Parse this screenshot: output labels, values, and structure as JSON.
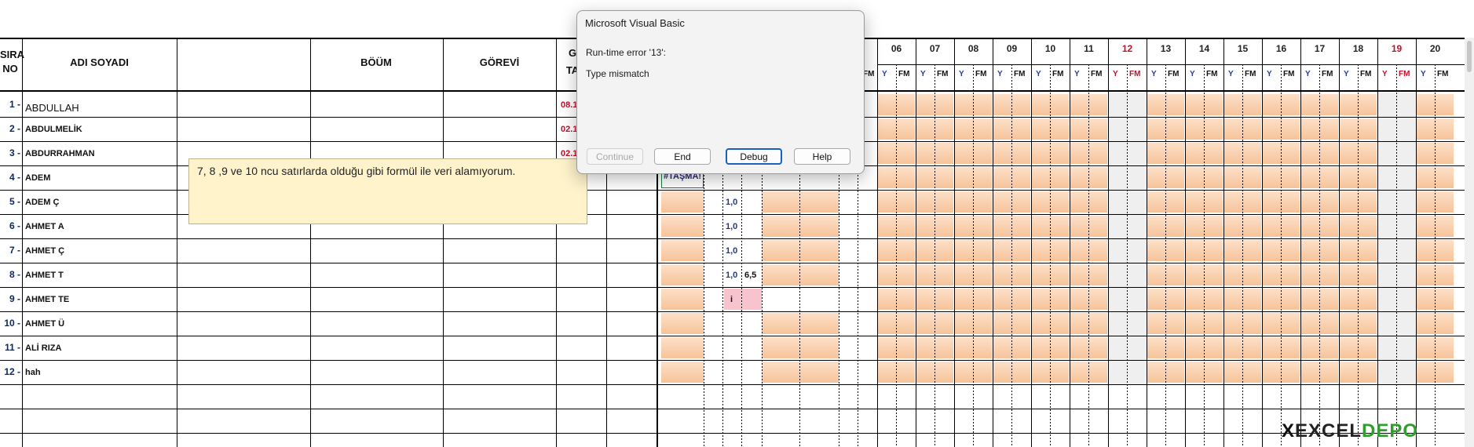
{
  "header": {
    "sira_line1": "SIRA",
    "sira_line2": "NO",
    "adi_soyadi": "ADI SOYADI",
    "bolum": "BÖÜM",
    "gorevi": "GÖREVİ",
    "g_partial": "G",
    "ta_partial": "TA",
    "fm_partial": "FM"
  },
  "days": [
    {
      "label": "06",
      "red": false
    },
    {
      "label": "07",
      "red": false
    },
    {
      "label": "08",
      "red": false
    },
    {
      "label": "09",
      "red": false
    },
    {
      "label": "10",
      "red": false
    },
    {
      "label": "11",
      "red": false
    },
    {
      "label": "12",
      "red": true
    },
    {
      "label": "13",
      "red": false
    },
    {
      "label": "14",
      "red": false
    },
    {
      "label": "15",
      "red": false
    },
    {
      "label": "16",
      "red": false
    },
    {
      "label": "17",
      "red": false
    },
    {
      "label": "18",
      "red": false
    },
    {
      "label": "19",
      "red": true
    },
    {
      "label": "20",
      "red": false
    }
  ],
  "yfm": {
    "y": "Y",
    "fm": "FM"
  },
  "rows": [
    {
      "no": "1 -",
      "name": "ABDULLAH",
      "date": "08.1"
    },
    {
      "no": "2 -",
      "name": "ABDULMELİK",
      "date": "02.1"
    },
    {
      "no": "3 -",
      "name": "ABDURRAHMAN",
      "date": "02.1"
    },
    {
      "no": "4 -",
      "name": "ADEM",
      "date": ""
    },
    {
      "no": "5 -",
      "name": "ADEM Ç",
      "date": ""
    },
    {
      "no": "6 -",
      "name": "AHMET A",
      "date": ""
    },
    {
      "no": "7 -",
      "name": "AHMET Ç",
      "date": ""
    },
    {
      "no": "8 -",
      "name": "AHMET T",
      "date": ""
    },
    {
      "no": "9 -",
      "name": "AHMET TE",
      "date": ""
    },
    {
      "no": "10 -",
      "name": "AHMET Ü",
      "date": ""
    },
    {
      "no": "11 -",
      "name": "ALİ RIZA",
      "date": ""
    },
    {
      "no": "12 -",
      "name": "hah",
      "date": ""
    }
  ],
  "cells": {
    "r5": "1,0",
    "r6": "1,0",
    "r7": "1,0",
    "r8a": "1,0",
    "r8b": "6,5",
    "r9": "i",
    "error": "#TAŞMA!"
  },
  "comment": "7, 8 ,9 ve 10 ncu satırlarda olduğu gibi formül ile veri alamıyorum.",
  "dialog": {
    "title": "Microsoft Visual Basic",
    "message1": "Run-time error '13':",
    "message2": "Type mismatch",
    "buttons": {
      "continue": "Continue",
      "end": "End",
      "debug": "Debug",
      "help": "Help"
    }
  },
  "logo": {
    "x": "X",
    "rest": "EXCEL",
    "d": "DEPO"
  }
}
